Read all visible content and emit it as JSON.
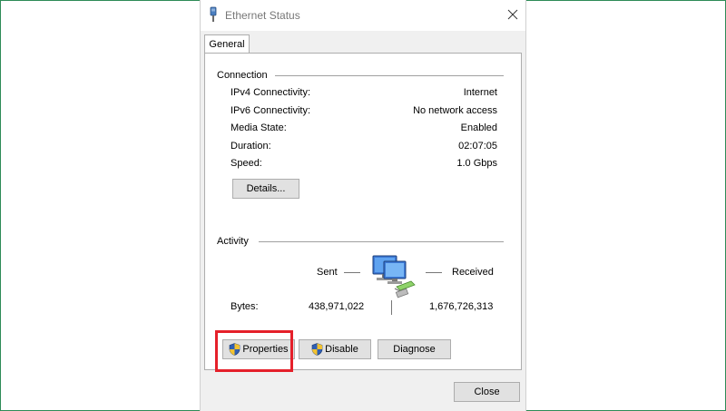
{
  "window": {
    "title": "Ethernet Status",
    "tab": "General"
  },
  "connection": {
    "heading": "Connection",
    "rows": [
      {
        "label": "IPv4 Connectivity:",
        "value": "Internet"
      },
      {
        "label": "IPv6 Connectivity:",
        "value": "No network access"
      },
      {
        "label": "Media State:",
        "value": "Enabled"
      },
      {
        "label": "Duration:",
        "value": "02:07:05"
      },
      {
        "label": "Speed:",
        "value": "1.0 Gbps"
      }
    ],
    "details_label": "Details..."
  },
  "activity": {
    "heading": "Activity",
    "sent_label": "Sent",
    "received_label": "Received",
    "bytes_label": "Bytes:",
    "bytes_sent": "438,971,022",
    "bytes_received": "1,676,726,313"
  },
  "buttons": {
    "properties": "Properties",
    "disable": "Disable",
    "diagnose": "Diagnose",
    "close": "Close"
  },
  "colors": {
    "highlight": "#e5202a",
    "window_bg": "#f0f0f0",
    "button_bg": "#e1e1e1"
  }
}
